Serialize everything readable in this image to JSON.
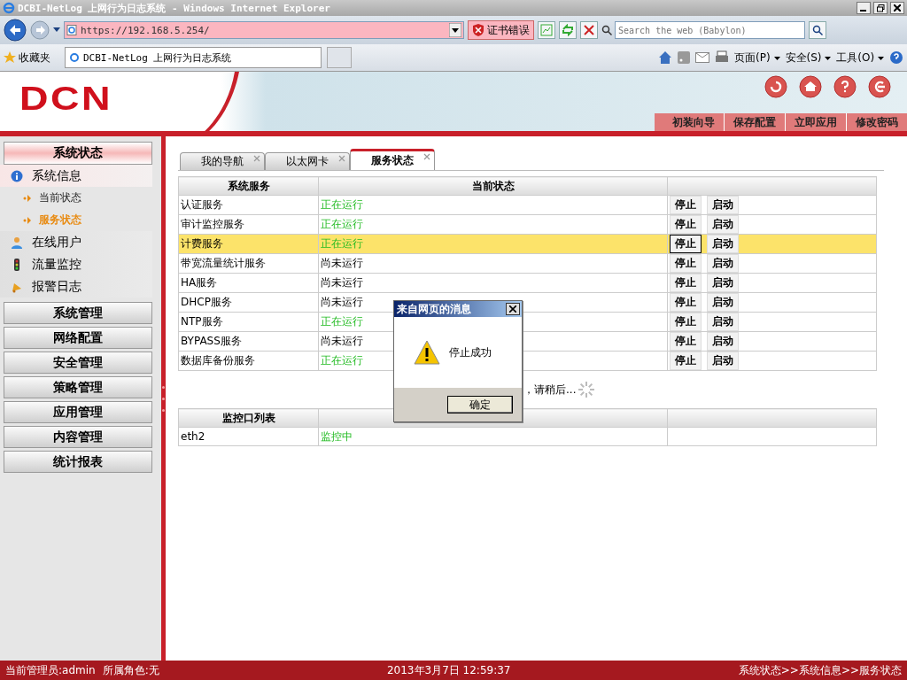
{
  "browser": {
    "title": "DCBI-NetLog 上网行为日志系统 - Windows Internet Explorer",
    "address": "https://192.168.5.254/",
    "cert_error": "证书错误",
    "search_placeholder": "Search the web (Babylon)",
    "favorites": "收藏夹",
    "tab_title": "DCBI-NetLog 上网行为日志系统",
    "menus": [
      "页面(P)",
      "安全(S)",
      "工具(O)"
    ]
  },
  "header": {
    "logo": "DCN",
    "links": [
      "初装向导",
      "保存配置",
      "立即应用",
      "修改密码"
    ]
  },
  "sidebar": {
    "active_section": "系统状态",
    "items": [
      {
        "label": "系统信息",
        "expanded": true,
        "children": [
          {
            "label": "当前状态",
            "selected": false
          },
          {
            "label": "服务状态",
            "selected": true
          }
        ]
      },
      {
        "label": "在线用户",
        "expanded": false
      },
      {
        "label": "流量监控",
        "expanded": false
      },
      {
        "label": "报警日志",
        "expanded": false
      }
    ],
    "sections": [
      "系统管理",
      "网络配置",
      "安全管理",
      "策略管理",
      "应用管理",
      "内容管理",
      "统计报表"
    ]
  },
  "tabs": [
    {
      "label": "我的导航",
      "selected": false
    },
    {
      "label": "以太网卡",
      "selected": false
    },
    {
      "label": "服务状态",
      "selected": true
    }
  ],
  "services": {
    "columns": [
      "系统服务",
      "当前状态"
    ],
    "rows": [
      {
        "name": "认证服务",
        "status": "正在运行",
        "running": true,
        "selected": false,
        "actions": [
          "停止",
          "启动"
        ]
      },
      {
        "name": "审计监控服务",
        "status": "正在运行",
        "running": true,
        "selected": false,
        "actions": [
          "停止",
          "启动"
        ]
      },
      {
        "name": "计费服务",
        "status": "正在运行",
        "running": true,
        "selected": true,
        "actions": [
          "停止",
          "启动"
        ]
      },
      {
        "name": "带宽流量统计服务",
        "status": "尚未运行",
        "running": false,
        "selected": false,
        "actions": [
          "停止",
          "启动"
        ]
      },
      {
        "name": "HA服务",
        "status": "尚未运行",
        "running": false,
        "selected": false,
        "actions": [
          "停止",
          "启动"
        ]
      },
      {
        "name": "DHCP服务",
        "status": "尚未运行",
        "running": false,
        "selected": false,
        "actions": [
          "停止",
          "启动"
        ]
      },
      {
        "name": "NTP服务",
        "status": "正在运行",
        "running": true,
        "selected": false,
        "actions": [
          "停止",
          "启动"
        ]
      },
      {
        "name": "BYPASS服务",
        "status": "尚未运行",
        "running": false,
        "selected": false,
        "actions": [
          "停止",
          "启动"
        ]
      },
      {
        "name": "数据库备份服务",
        "status": "正在运行",
        "running": true,
        "selected": false,
        "actions": [
          "停止",
          "启动"
        ]
      }
    ]
  },
  "loading": "，请稍后...",
  "monitor": {
    "columns": [
      "监控口列表"
    ],
    "rows": [
      {
        "port": "eth2",
        "status": "监控中"
      }
    ]
  },
  "dialog": {
    "title": "来自网页的消息",
    "message": "停止成功",
    "button": "确定"
  },
  "status_bar": {
    "admin": "当前管理员:admin",
    "role": "所属角色:无",
    "time": "2013年3月7日 12:59:37",
    "breadcrumb": "系统状态>>系统信息>>服务状态"
  }
}
